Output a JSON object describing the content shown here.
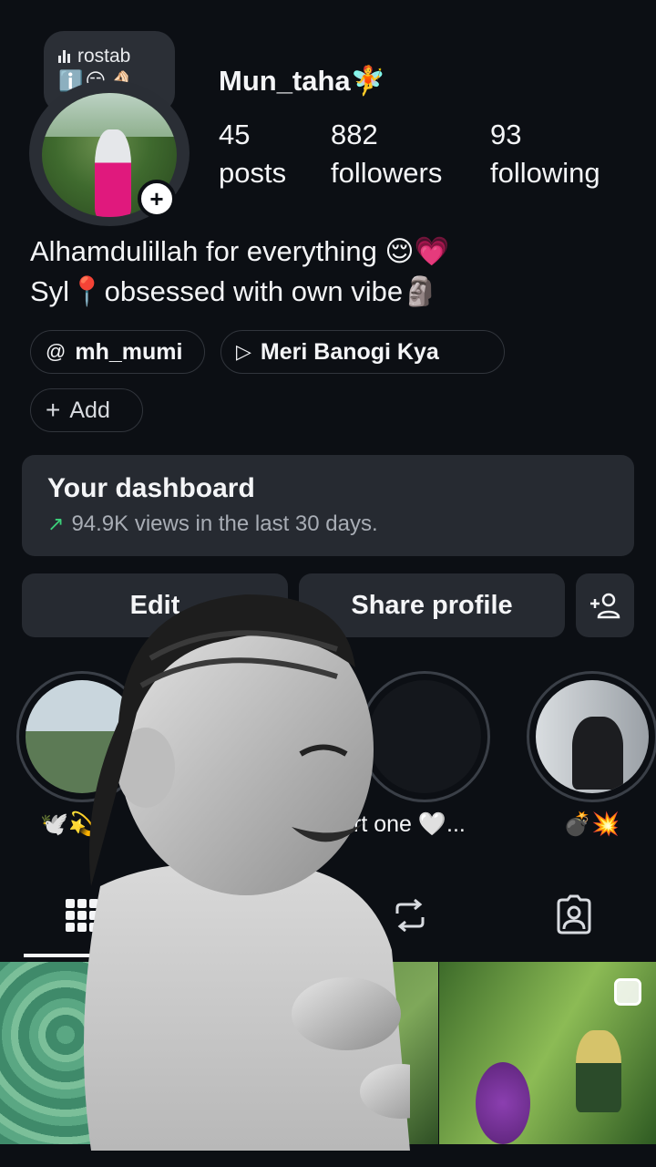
{
  "profile": {
    "note_text": "rostab",
    "note_emojis": "ℹ️😑🤌🏻",
    "username": "Mun_taha🧚",
    "stats": [
      {
        "value": "45",
        "label": "posts"
      },
      {
        "value": "882",
        "label": "followers"
      },
      {
        "value": "93",
        "label": "following"
      }
    ],
    "bio_line1": "Alhamdulillah for everything 😌💗",
    "bio_line2": "Syl📍obsessed with own vibe🗿",
    "link_threads": "mh_mumi",
    "link_music": "Meri Banogi Kya",
    "add_label": "Add"
  },
  "dashboard": {
    "title": "Your dashboard",
    "subtitle": "94.9K views in the last 30 days."
  },
  "buttons": {
    "edit": "Edit",
    "share": "Share profile"
  },
  "highlights": [
    {
      "label": "🕊️💫"
    },
    {
      "label": "rt one 🤍..."
    },
    {
      "label": "💣💥"
    }
  ],
  "icons": {
    "threads": "threads-icon",
    "music": "play-icon",
    "add": "plus-icon",
    "trend": "trend-up-icon",
    "add_user": "add-user-icon",
    "grid": "grid-icon",
    "reels": "repost-icon",
    "tagged": "tagged-icon"
  },
  "colors": {
    "background": "#0c0f14",
    "card": "#262a31",
    "trend": "#3cd07a"
  }
}
